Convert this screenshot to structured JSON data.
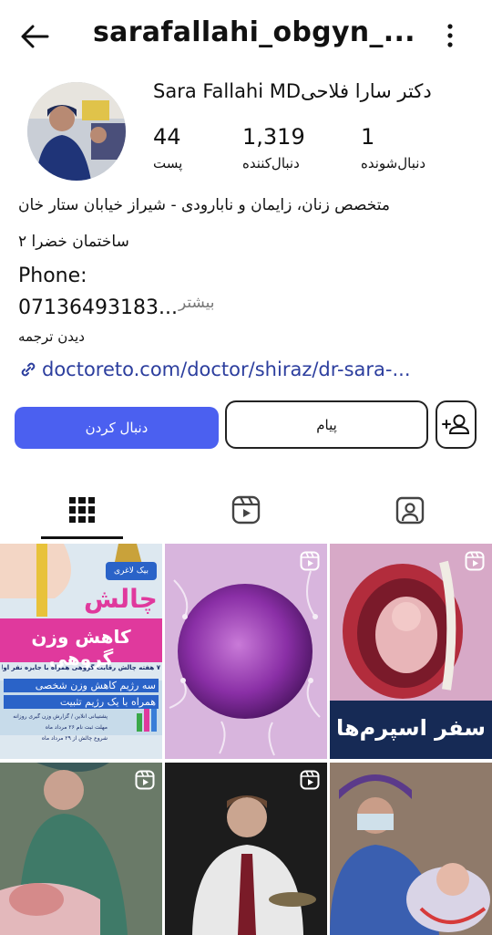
{
  "header": {
    "username": "sarafallahi_obgyn_...",
    "back_icon": "arrow-left-icon",
    "menu_icon": "kebab-menu-icon"
  },
  "profile": {
    "full_name": "Sara Fallahi MDدکتر سارا فلاحی",
    "stats": [
      {
        "value": "44",
        "label": "پست"
      },
      {
        "value": "1,319",
        "label": "دنبال‌کننده"
      },
      {
        "value": "1",
        "label": "دنبال‌شونده"
      }
    ],
    "bio_line1": "متخصص زنان، زایمان و نابارودی - شیراز خیابان ستار خان",
    "bio_line2": "ساختمان خضرا ۲",
    "phone_label": "Phone:",
    "phone_number": "07136493183...",
    "more_label": "بیشتر",
    "translate_label": "دیدن ترجمه",
    "link": "doctoreto.com/doctor/shiraz/dr-sara-..."
  },
  "actions": {
    "follow": "دنبال کردن",
    "message": "پیام",
    "add_user_icon": "add-user-icon"
  },
  "tabs": [
    {
      "icon": "grid-icon",
      "active": true
    },
    {
      "icon": "reels-icon",
      "active": false
    },
    {
      "icon": "tagged-icon",
      "active": false
    }
  ],
  "grid": {
    "post1": {
      "badge": "بیک لاغری",
      "title": "چالش",
      "subtitle": "کاهش وزن گروهی",
      "line1": "۷ هفته چالش رقابت گروهی همراه با جایزه نفر اول",
      "line2": "سه رژیم کاهش وزن شخصی",
      "line3": "همراه با یک رژیم تثبیت",
      "line4": "پشتیبانی آنلاین / گزارش وزن گیری روزانه",
      "line5": "مهلت ثبت نام ۲۶ مرداد ماه",
      "line6": "شروع چالش از ۲۹ مرداد ماه"
    },
    "post3": {
      "caption": "سفر اسپرم‌ها"
    }
  },
  "colors": {
    "accent": "#4b60f0",
    "link": "#2c3e9e"
  }
}
